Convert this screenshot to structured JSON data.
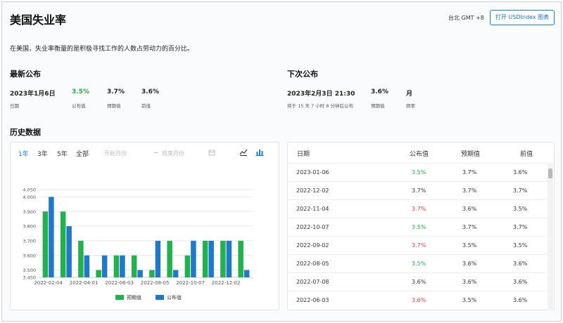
{
  "header": {
    "title": "美国失业率",
    "timezone": "台北 GMT +8",
    "open_button": "打开 USDIndex 图表"
  },
  "description": "在美国，失业率衡量的是积极寻找工作的人数占劳动力的百分比。",
  "latest": {
    "heading": "最新公布",
    "date": "2023年1月6日",
    "date_label": "日期",
    "actual": "3.5%",
    "actual_label": "公布值",
    "forecast": "3.7%",
    "forecast_label": "预期值",
    "previous": "3.6%",
    "previous_label": "前值"
  },
  "next": {
    "heading": "下次公布",
    "datetime": "2023年2月3日 21:30",
    "countdown": "将于 15 天 7 小时 8 分钟后公布",
    "forecast": "3.6%",
    "forecast_label": "预期值",
    "frequency": "月",
    "frequency_label": "频率"
  },
  "history": {
    "heading": "历史数据",
    "ranges": [
      "1年",
      "3年",
      "5年",
      "全部"
    ],
    "active_range": "1年",
    "start_placeholder": "开始月份",
    "end_placeholder": "结束月份",
    "table_headers": [
      "日期",
      "公布值",
      "预期值",
      "前值"
    ],
    "rows": [
      {
        "date": "2023-01-06",
        "actual": "3.5%",
        "actual_color": "green",
        "forecast": "3.7%",
        "previous": "3.6%"
      },
      {
        "date": "2022-12-02",
        "actual": "3.7%",
        "actual_color": "neutral",
        "forecast": "3.7%",
        "previous": "3.7%"
      },
      {
        "date": "2022-11-04",
        "actual": "3.7%",
        "actual_color": "red",
        "forecast": "3.6%",
        "previous": "3.5%"
      },
      {
        "date": "2022-10-07",
        "actual": "3.5%",
        "actual_color": "green",
        "forecast": "3.7%",
        "previous": "3.7%"
      },
      {
        "date": "2022-09-02",
        "actual": "3.7%",
        "actual_color": "red",
        "forecast": "3.5%",
        "previous": "3.5%"
      },
      {
        "date": "2022-08-05",
        "actual": "3.5%",
        "actual_color": "green",
        "forecast": "3.6%",
        "previous": "3.6%"
      },
      {
        "date": "2022-07-08",
        "actual": "3.6%",
        "actual_color": "neutral",
        "forecast": "3.6%",
        "previous": "3.6%"
      },
      {
        "date": "2022-06-03",
        "actual": "3.6%",
        "actual_color": "red",
        "forecast": "3.5%",
        "previous": "3.6%"
      }
    ]
  },
  "colors": {
    "forecast_bar": "#22b14c",
    "actual_bar": "#1f78c8",
    "accent": "#1a7fc8",
    "positive": "#2aa84a",
    "negative": "#d64545"
  },
  "chart_data": {
    "type": "bar",
    "categories": [
      "2022-02-04",
      "2022-03-04",
      "2022-04-01",
      "2022-05-06",
      "2022-06-03",
      "2022-07-08",
      "2022-08-05",
      "2022-09-02",
      "2022-10-07",
      "2022-11-04",
      "2022-12-02",
      "2023-01-06"
    ],
    "x_tick_labels": [
      "2022-02-04",
      "2022-04-01",
      "2022-06-03",
      "2022-08-05",
      "2022-10-07",
      "2022-12-02"
    ],
    "series": [
      {
        "name": "预期值",
        "color": "#22b14c",
        "values": [
          3.9,
          3.9,
          3.7,
          3.5,
          3.6,
          3.6,
          3.5,
          3.7,
          3.6,
          3.7,
          3.7,
          3.7
        ]
      },
      {
        "name": "公布值",
        "color": "#1f78c8",
        "values": [
          4.0,
          3.8,
          3.6,
          3.6,
          3.6,
          3.5,
          3.7,
          3.5,
          3.7,
          3.7,
          3.7,
          3.5
        ]
      }
    ],
    "y_ticks": [
      3.45,
      3.5,
      3.6,
      3.7,
      3.8,
      3.9,
      4.0,
      4.05
    ],
    "y_tick_labels": [
      "3.450",
      "3.500",
      "3.600",
      "3.700",
      "3.800",
      "3.900",
      "4.000",
      "4.050"
    ],
    "ylim": [
      3.45,
      4.05
    ],
    "grid": true,
    "legend": "bottom-center"
  }
}
